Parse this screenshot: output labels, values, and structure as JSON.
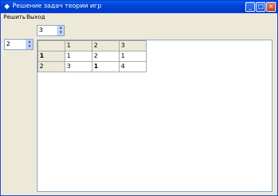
{
  "window": {
    "title": "Решение задач теории игр",
    "buttons": [
      "_",
      "□",
      "×"
    ]
  },
  "menu": {
    "items": [
      "Решить",
      "Выход"
    ]
  },
  "columns_spinner": {
    "value": "3"
  },
  "rows_spinner": {
    "value": "2"
  },
  "grid": {
    "header": [
      "",
      "1",
      "2",
      "3"
    ],
    "rows": [
      {
        "label": "1",
        "cells": [
          "1",
          "2",
          "1"
        ]
      },
      {
        "label": "2",
        "cells": [
          "3",
          "1",
          "4"
        ]
      }
    ]
  }
}
